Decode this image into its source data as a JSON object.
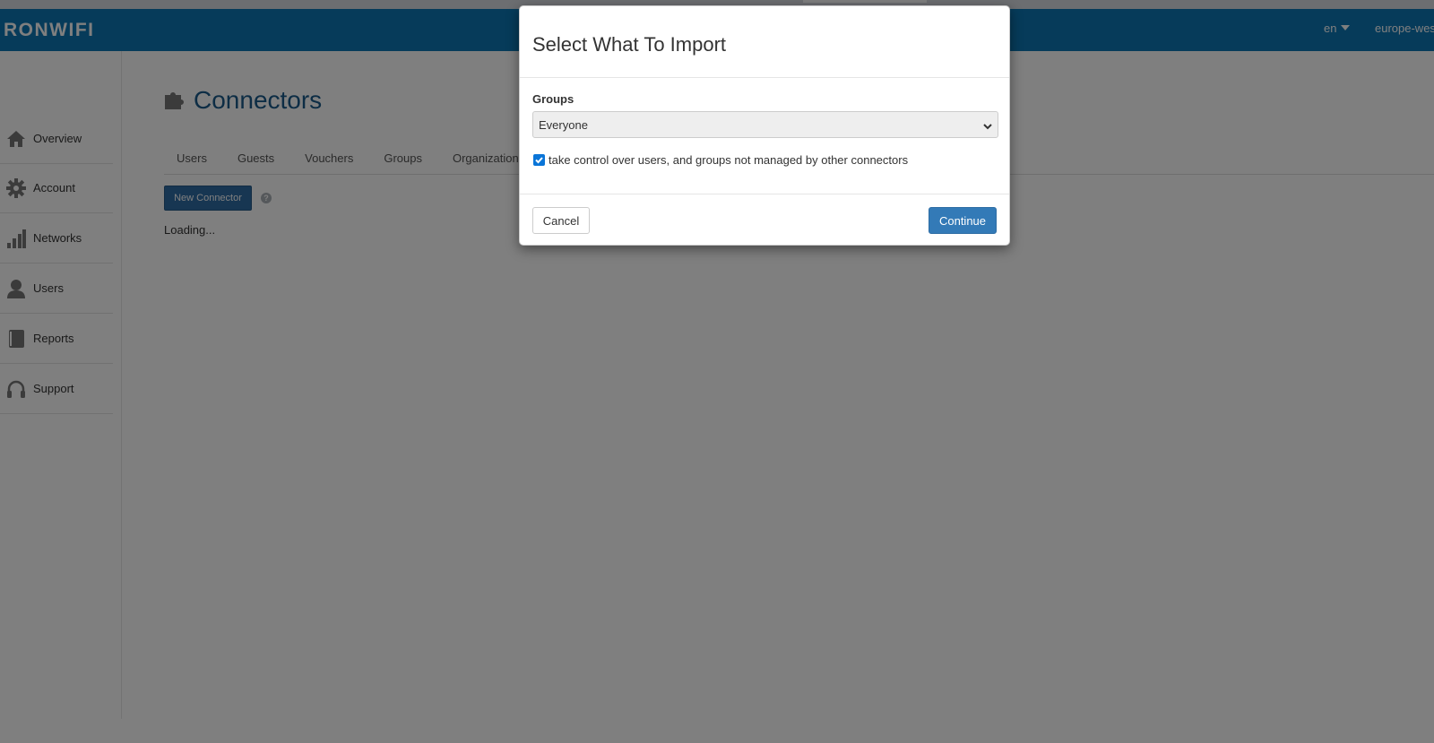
{
  "header": {
    "logo": "RONWIFI",
    "language": "en",
    "region": "europe-wes"
  },
  "sidebar": {
    "items": [
      {
        "label": "Overview",
        "icon": "home-icon"
      },
      {
        "label": "Account",
        "icon": "gear-icon"
      },
      {
        "label": "Networks",
        "icon": "signal-bars-icon"
      },
      {
        "label": "Users",
        "icon": "user-icon"
      },
      {
        "label": "Reports",
        "icon": "book-icon"
      },
      {
        "label": "Support",
        "icon": "headphones-icon"
      }
    ]
  },
  "main": {
    "title": "Connectors",
    "title_icon": "puzzle-icon",
    "tabs": [
      "Users",
      "Guests",
      "Vouchers",
      "Groups",
      "Organizational"
    ],
    "new_button": "New Connector",
    "help_glyph": "?",
    "loading": "Loading..."
  },
  "modal": {
    "title": "Select What To Import",
    "groups_label": "Groups",
    "groups_selected": "Everyone",
    "checkbox_label": "take control over users, and groups not managed by other connectors",
    "checkbox_checked": true,
    "cancel_label": "Cancel",
    "continue_label": "Continue"
  },
  "colors": {
    "header_bg": "#0d76b5",
    "primary_button": "#337ab7",
    "title_color": "#1a5a8a"
  }
}
